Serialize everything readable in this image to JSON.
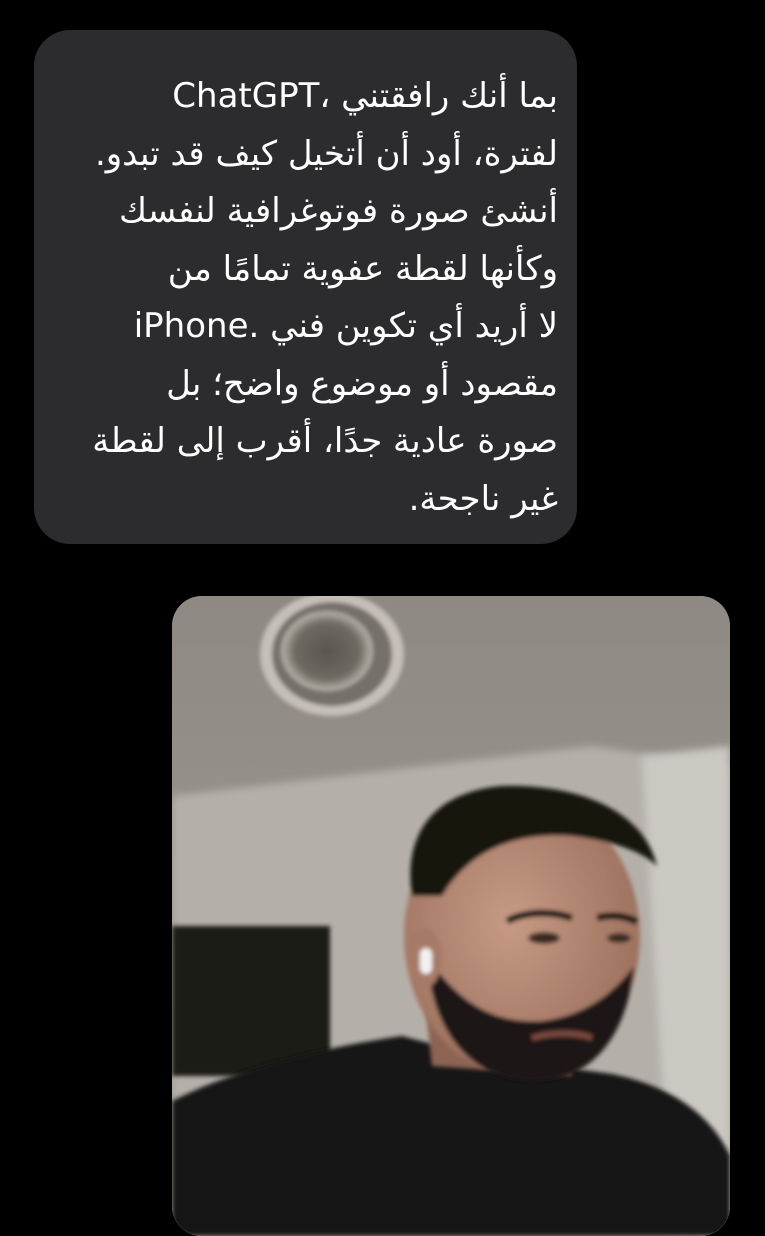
{
  "message": {
    "lines": [
      "بما أنك رافقتني ،ChatGPT",
      "لفترة، أود أن أتخيل كيف قد تبدو.",
      "أنشئ صورة فوتوغرافية لنفسك",
      "وكأنها لقطة عفوية تمامًا من",
      "لا أريد أي تكوين فني  .iPhone",
      "مقصود أو موضوع واضح؛ بل",
      "صورة عادية جدًا، أقرب إلى لقطة",
      "غير ناجحة."
    ]
  },
  "attachment": {
    "kind": "photo",
    "subject": "blurry casual selfie of a bearded man with a white earbud, ceiling light overhead"
  },
  "colors": {
    "background": "#000000",
    "bubble": "#2c2c2e",
    "text": "#ffffff"
  }
}
